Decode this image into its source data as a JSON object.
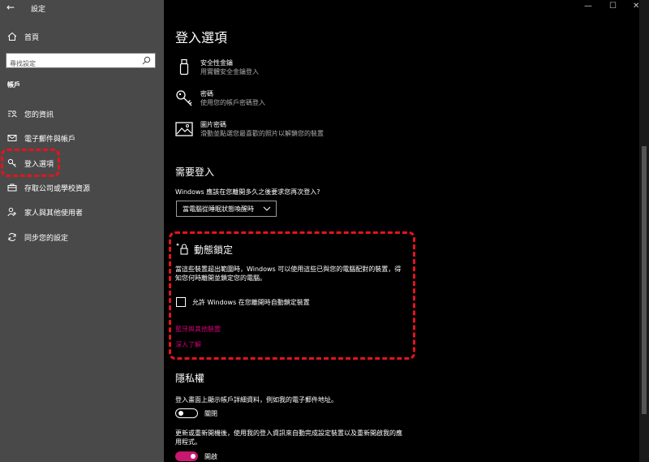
{
  "window": {
    "app_title": "設定",
    "back_glyph": "←",
    "minimize_glyph": "—",
    "maximize_glyph": "☐",
    "close_glyph": "✕"
  },
  "sidebar": {
    "home_label": "首頁",
    "search_placeholder": "尋找設定",
    "section_label": "帳戶",
    "items": [
      {
        "label": "您的資訊",
        "icon": "person-card-icon"
      },
      {
        "label": "電子郵件與帳戶",
        "icon": "mail-icon"
      },
      {
        "label": "登入選項",
        "icon": "key-icon",
        "selected": true
      },
      {
        "label": "存取公司或學校資源",
        "icon": "briefcase-icon"
      },
      {
        "label": "家人與其他使用者",
        "icon": "people-icon"
      },
      {
        "label": "同步您的設定",
        "icon": "sync-icon"
      }
    ]
  },
  "main": {
    "title": "登入選項",
    "options": [
      {
        "title": "安全性金鑰",
        "desc": "用實體安全金鑰登入",
        "icon": "usb-key-icon"
      },
      {
        "title": "密碼",
        "desc": "使用您的帳戶密碼登入",
        "icon": "key-icon"
      },
      {
        "title": "圖片密碼",
        "desc": "滑動並點選您最喜歡的照片以解鎖您的裝置",
        "icon": "picture-icon"
      }
    ],
    "require_signin": {
      "heading": "需要登入",
      "question": "Windows 應該在您離開多久之後要求您再次登入?",
      "dropdown_value": "當電腦從睡眠狀態喚醒時"
    },
    "dynamic_lock": {
      "heading": "動態鎖定",
      "description": "當這些裝置超出範圍時，Windows 可以使用這些已與您的電腦配對的裝置，得知您何時離開並鎖定您的電腦。",
      "checkbox_label": "允許 Windows 在您離開時自動鎖定裝置",
      "checkbox_checked": false,
      "link1": "藍牙與其他裝置",
      "link2": "深入了解"
    },
    "privacy": {
      "heading": "隱私權",
      "setting1": "登入畫面上顯示帳戶詳細資料，例如我的電子郵件地址。",
      "toggle1_label": "關閉",
      "toggle1_on": false,
      "setting2": "更新或重新開機後，使用我的登入資訊來自動完成設定裝置以及重新開啟我的應用程式。",
      "toggle2_label": "開啟",
      "toggle2_on": true
    }
  },
  "colors": {
    "sidebar_bg": "#494949",
    "main_bg": "#000000",
    "accent": "#c8176e",
    "link": "#d40078",
    "highlight": "#e4141e"
  }
}
